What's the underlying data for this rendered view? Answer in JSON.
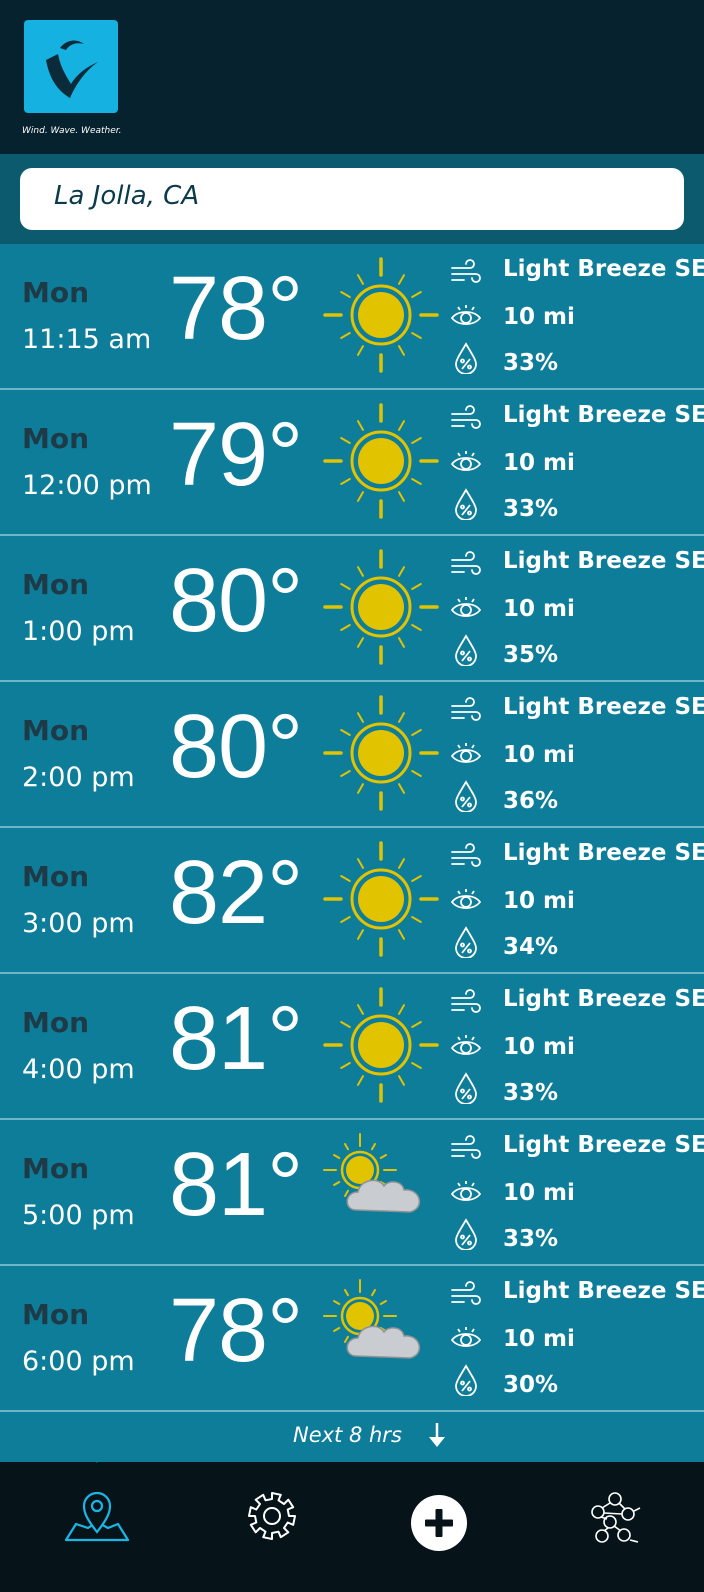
{
  "app": {
    "tagline": "Wind. Wave. Weather."
  },
  "search": {
    "location": "La Jolla, CA"
  },
  "rows": [
    {
      "day": "Mon",
      "time": "11:15 am",
      "temp": "78°",
      "condition": "sunny",
      "wind": "Light Breeze SE",
      "visibility": "10 mi",
      "humidity": "33%"
    },
    {
      "day": "Mon",
      "time": "12:00 pm",
      "temp": "79°",
      "condition": "sunny",
      "wind": "Light Breeze SE",
      "visibility": "10 mi",
      "humidity": "33%"
    },
    {
      "day": "Mon",
      "time": "1:00 pm",
      "temp": "80°",
      "condition": "sunny",
      "wind": "Light Breeze SE",
      "visibility": "10 mi",
      "humidity": "35%"
    },
    {
      "day": "Mon",
      "time": "2:00 pm",
      "temp": "80°",
      "condition": "sunny",
      "wind": "Light Breeze SE",
      "visibility": "10 mi",
      "humidity": "36%"
    },
    {
      "day": "Mon",
      "time": "3:00 pm",
      "temp": "82°",
      "condition": "sunny",
      "wind": "Light Breeze SE",
      "visibility": "10 mi",
      "humidity": "34%"
    },
    {
      "day": "Mon",
      "time": "4:00 pm",
      "temp": "81°",
      "condition": "sunny",
      "wind": "Light Breeze SE",
      "visibility": "10 mi",
      "humidity": "33%"
    },
    {
      "day": "Mon",
      "time": "5:00 pm",
      "temp": "81°",
      "condition": "partly-cloudy",
      "wind": "Light Breeze SE",
      "visibility": "10 mi",
      "humidity": "33%"
    },
    {
      "day": "Mon",
      "time": "6:00 pm",
      "temp": "78°",
      "condition": "partly-cloudy",
      "wind": "Light Breeze SE",
      "visibility": "10 mi",
      "humidity": "30%"
    }
  ],
  "footer": {
    "next_label": "Next 8 hrs"
  },
  "tabs": [
    {
      "icon": "map-pin-icon",
      "active": true
    },
    {
      "icon": "gear-icon",
      "active": false
    },
    {
      "icon": "plus-icon",
      "active": false
    },
    {
      "icon": "people-network-icon",
      "active": false
    }
  ],
  "colors": {
    "header": "#06222e",
    "row": "#0d7d99",
    "logo": "#15b1e0",
    "sun": "#e2c300",
    "active_tab": "#19b7e6"
  }
}
